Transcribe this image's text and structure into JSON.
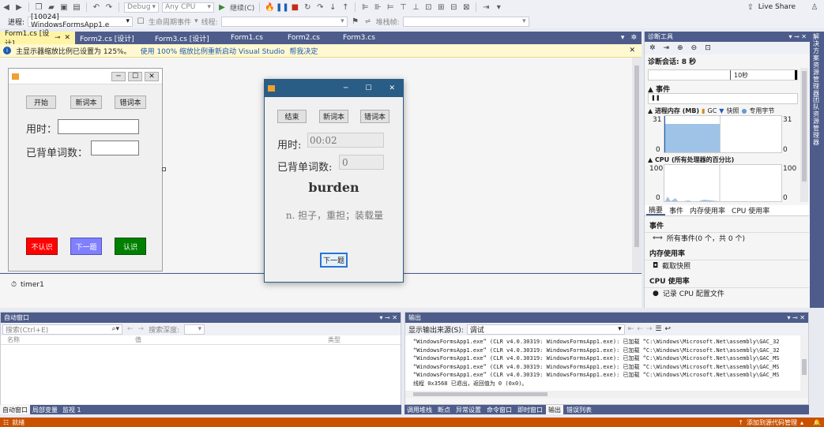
{
  "toolbar": {
    "config": "Debug",
    "platform": "Any CPU",
    "continue_label": "继续(C)",
    "live_share": "Live Share",
    "process_label": "进程:",
    "process_value": "[10024] WindowsFormsApp1.e",
    "lifecycle_label": "生命周期事件",
    "thread_label": "线程:",
    "stackframe_label": "堆栈帧:"
  },
  "tabs": [
    {
      "label": "Form1.cs [设计]",
      "active": true
    },
    {
      "label": "Form2.cs [设计]"
    },
    {
      "label": "Form3.cs [设计]"
    },
    {
      "label": "Form1.cs"
    },
    {
      "label": "Form2.cs"
    },
    {
      "label": "Form3.cs"
    }
  ],
  "infobar": {
    "message": "主显示器缩放比例已设置为 125%。",
    "link1": "使用 100% 缩放比例重新启动 Visual Studio",
    "link2": "帮我决定"
  },
  "design_form": {
    "btn_start": "开始",
    "btn_new": "新词本",
    "btn_wrong": "错词本",
    "time_label": "用时：",
    "count_label": "已背单词数：",
    "btn_unknown": "不认识",
    "btn_next": "下一题",
    "btn_known": "认识",
    "timer": "timer1"
  },
  "running_form": {
    "btn_end": "结束",
    "btn_new": "新词本",
    "btn_wrong": "错词本",
    "time_label": "用时:",
    "time_value": "00:02",
    "count_label": "已背单词数:",
    "count_value": "0",
    "word": "burden",
    "meaning": "n. 担子，重担；装载量",
    "btn_next": "下一题"
  },
  "diagnostics": {
    "title": "诊断工具",
    "session": "诊断会话: 8 秒",
    "time_tick": "10秒",
    "events_title": "事件",
    "memory_title": "进程内存 (MB)",
    "legend_gc": "GC",
    "legend_snapshot": "快照",
    "legend_private": "专用字节",
    "mem_max": "31",
    "mem_min": "0",
    "cpu_title": "CPU (所有处理器的百分比)",
    "cpu_max": "100",
    "cpu_min": "0",
    "subtabs": [
      "摘要",
      "事件",
      "内存使用率",
      "CPU 使用率"
    ],
    "sec_events": "事件",
    "all_events": "所有事件(0 个，共 0 个)",
    "sec_memory": "内存使用率",
    "take_snapshot": "截取快照",
    "sec_cpu": "CPU 使用率",
    "record_cpu": "记录 CPU 配置文件",
    "side_tabs": [
      "解决方案资源管理器",
      "团队资源管理器"
    ]
  },
  "autos": {
    "title": "自动窗口",
    "search_placeholder": "搜索(Ctrl+E)",
    "search_depth": "搜索深度:",
    "col_name": "名称",
    "col_value": "值",
    "col_type": "类型",
    "tabs": [
      "自动窗口",
      "局部变量",
      "监视 1"
    ]
  },
  "output": {
    "title": "输出",
    "source_label": "显示输出来源(S):",
    "source_value": "调试",
    "lines": [
      "“WindowsFormsApp1.exe” (CLR v4.0.30319: WindowsFormsApp1.exe): 已加载 “C:\\Windows\\Microsoft.Net\\assembly\\GAC_32",
      "“WindowsFormsApp1.exe” (CLR v4.0.30319: WindowsFormsApp1.exe): 已加载 “C:\\Windows\\Microsoft.Net\\assembly\\GAC_32",
      "“WindowsFormsApp1.exe” (CLR v4.0.30319: WindowsFormsApp1.exe): 已加载 “C:\\Windows\\Microsoft.Net\\assembly\\GAC_MS",
      "“WindowsFormsApp1.exe” (CLR v4.0.30319: WindowsFormsApp1.exe): 已加载 “C:\\Windows\\Microsoft.Net\\assembly\\GAC_MS",
      "“WindowsFormsApp1.exe” (CLR v4.0.30319: WindowsFormsApp1.exe): 已加载 “C:\\Windows\\Microsoft.Net\\assembly\\GAC_MS",
      "线程 0x3568 已退出，返回值为 0 (0x0)。"
    ],
    "tabs": [
      "调用堆栈",
      "断点",
      "异常设置",
      "命令窗口",
      "即时窗口",
      "输出",
      "错误列表"
    ]
  },
  "statusbar": {
    "left": "就绪",
    "right": "添加到源代码管理"
  },
  "colors": {
    "accent": "#4d5c8a",
    "status": "#ca5100",
    "tab_active": "#fff4a5",
    "btn_red": "#ff0000",
    "btn_blue": "#8080ff",
    "btn_green": "#008000"
  }
}
